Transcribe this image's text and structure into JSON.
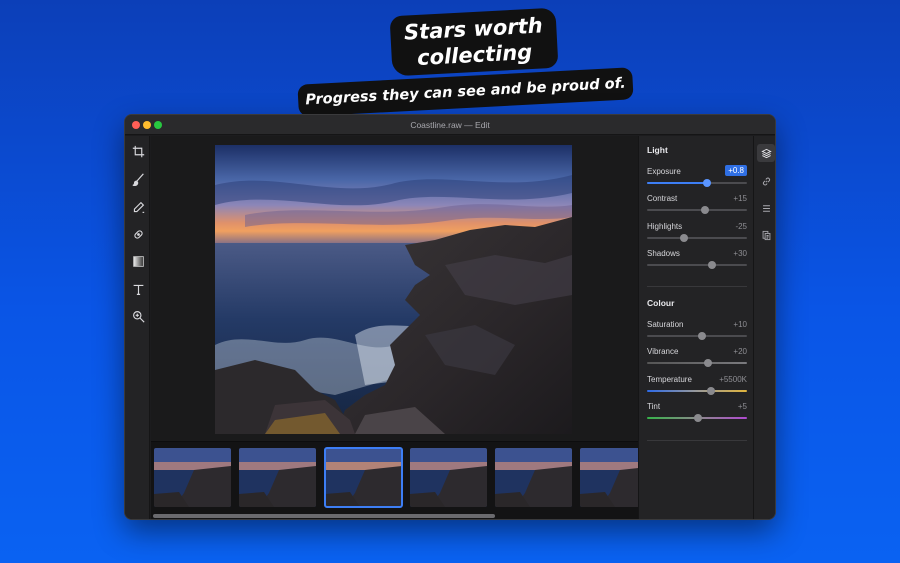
{
  "headline": {
    "title_line1": "Stars worth",
    "title_line2": "collecting",
    "subtitle": "Progress they can see and be proud of."
  },
  "window": {
    "title": "Coastline.raw — Edit"
  },
  "tools": [
    "crop-icon",
    "brush-icon",
    "eyedropper-icon",
    "heal-icon",
    "gradient-icon",
    "text-icon",
    "zoom-icon"
  ],
  "panel": {
    "light": {
      "title": "Light",
      "adjustments": [
        {
          "label": "Exposure",
          "value": "+0.8",
          "level": 0.6,
          "active": true
        },
        {
          "label": "Contrast",
          "value": "+15",
          "level": 0.58,
          "active": false
        },
        {
          "label": "Highlights",
          "value": "-25",
          "level": 0.37,
          "active": false
        },
        {
          "label": "Shadows",
          "value": "+30",
          "level": 0.65,
          "active": false
        }
      ]
    },
    "colour": {
      "title": "Colour",
      "adjustments": [
        {
          "label": "Saturation",
          "value": "+10",
          "level": 0.55
        },
        {
          "label": "Vibrance",
          "value": "+20",
          "level": 0.61
        },
        {
          "label": "Temperature",
          "value": "+5500K",
          "level": 0.64
        },
        {
          "label": "Tint",
          "value": "+5",
          "level": 0.51
        }
      ]
    }
  },
  "strip_icons": [
    "layers-icon",
    "link-icon",
    "list-icon",
    "presets-icon"
  ],
  "filmstrip": {
    "count_visible": 6,
    "selected_index": 2
  },
  "colors": {
    "accent": "#3d7ef5",
    "background": "#0a55e6",
    "window": "#1c1c1e"
  }
}
